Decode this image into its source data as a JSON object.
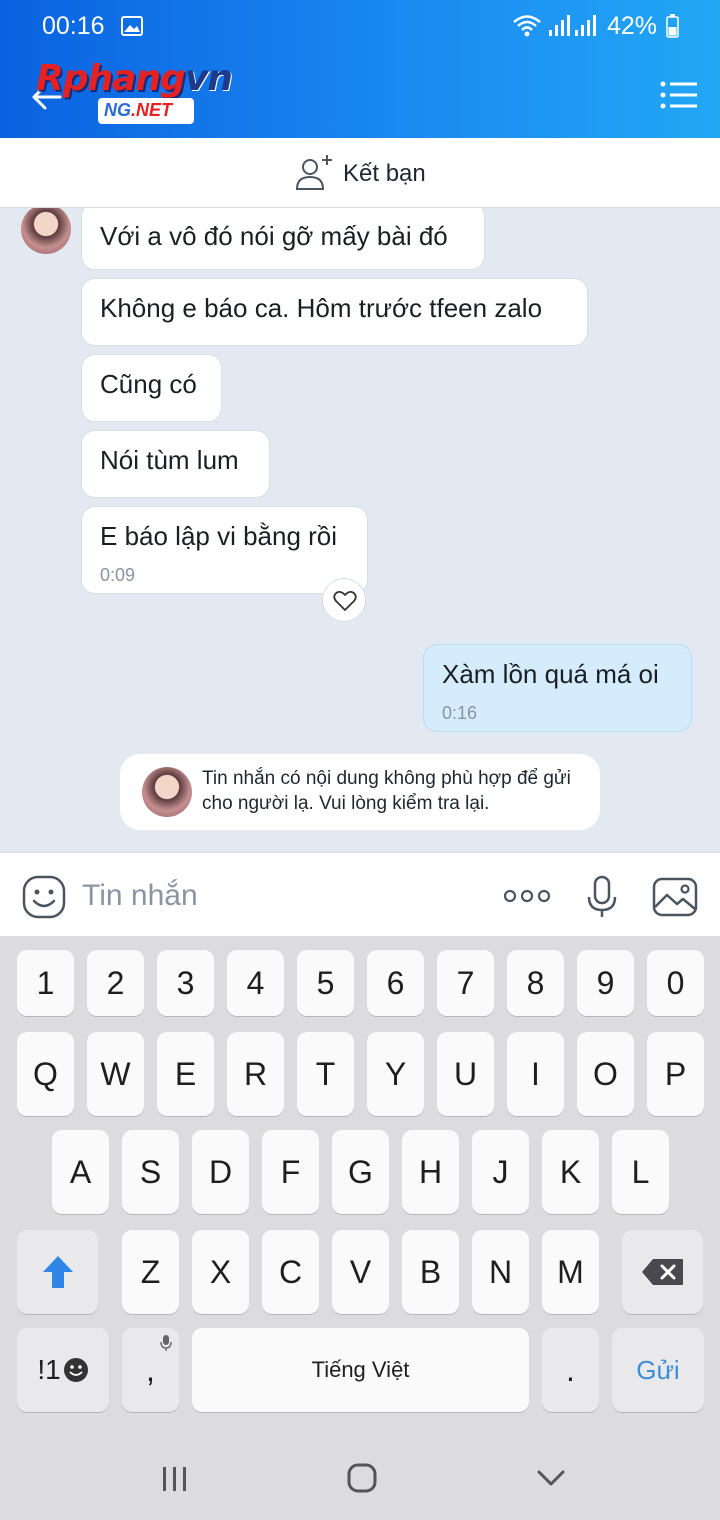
{
  "status_bar": {
    "time": "00:16",
    "battery": "42%"
  },
  "header": {
    "logo_main": "Rphang",
    "logo_suffix": "vn",
    "logo_badge_ng": "NG",
    "logo_badge_net": ".NET"
  },
  "friend_bar": {
    "label": "Kết bạn"
  },
  "messages": {
    "received": [
      {
        "text": "Với a vô đó nói gỡ mấy bài đó"
      },
      {
        "text": "Không e báo ca. Hôm trước tfeen zalo"
      },
      {
        "text": "Cũng có"
      },
      {
        "text": "Nói tùm lum"
      },
      {
        "text": "E báo lập vi bằng rồi",
        "time": "0:09"
      }
    ],
    "sent": [
      {
        "text": "Xàm lồn quá má oi",
        "time": "0:16"
      }
    ],
    "warning": "Tin nhắn có nội dung không phù hợp để gửi cho người lạ. Vui lòng kiểm tra lại."
  },
  "input": {
    "placeholder": "Tin nhắn"
  },
  "keyboard": {
    "numbers": [
      "1",
      "2",
      "3",
      "4",
      "5",
      "6",
      "7",
      "8",
      "9",
      "0"
    ],
    "row1": [
      "Q",
      "W",
      "E",
      "R",
      "T",
      "Y",
      "U",
      "I",
      "O",
      "P"
    ],
    "row2": [
      "A",
      "S",
      "D",
      "F",
      "G",
      "H",
      "J",
      "K",
      "L"
    ],
    "row3": [
      "Z",
      "X",
      "C",
      "V",
      "B",
      "N",
      "M"
    ],
    "symbols": "!1",
    "comma": ",",
    "space": "Tiếng Việt",
    "period": ".",
    "send": "Gửi"
  },
  "colors": {
    "header_start": "#0a62e0",
    "header_end": "#22a7f5",
    "sent_bubble": "#d5ecfd",
    "chat_bg": "#e2e9f1",
    "send_key": "#3a8fd9"
  },
  "icons": [
    "back-arrow-icon",
    "menu-icon",
    "add-friend-icon",
    "heart-icon",
    "emoji-icon",
    "more-icon",
    "mic-icon",
    "image-icon",
    "shift-icon",
    "backspace-icon"
  ]
}
